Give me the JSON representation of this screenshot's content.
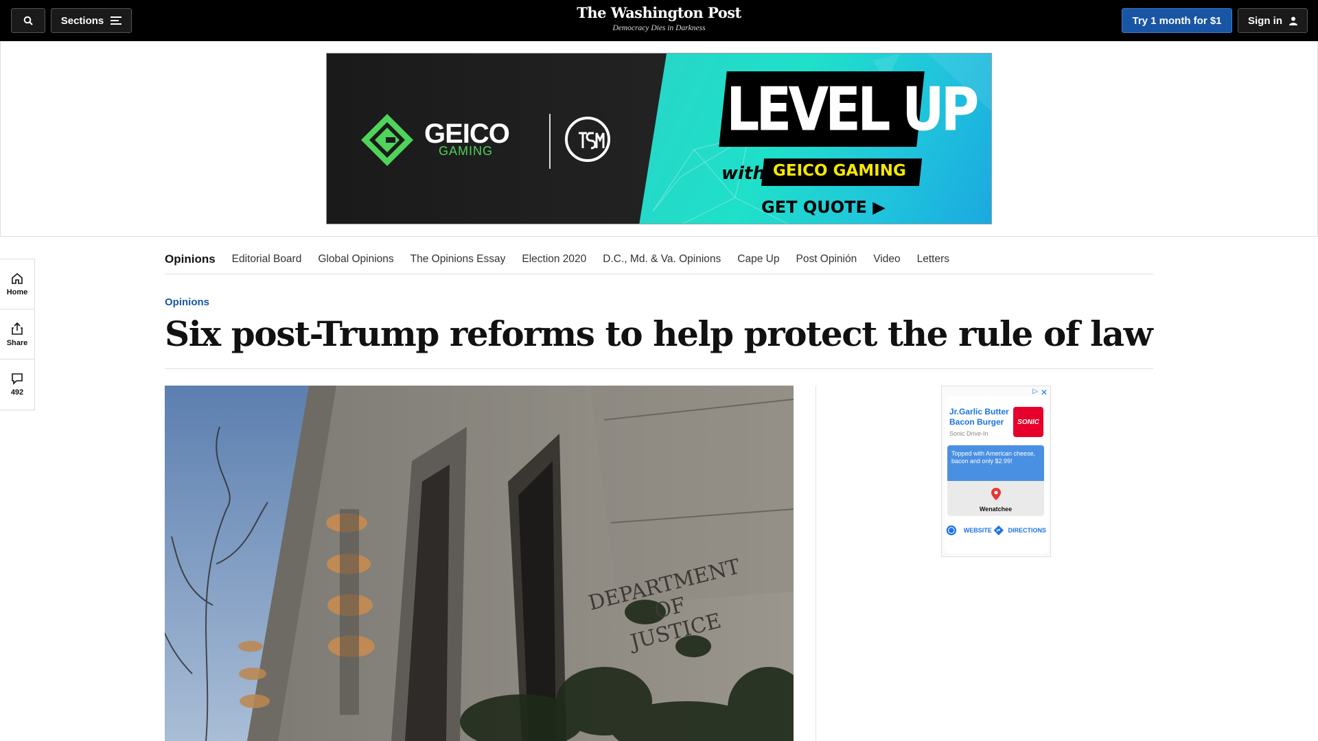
{
  "header": {
    "sections_label": "Sections",
    "masthead_title": "The Washington Post",
    "masthead_tagline": "Democracy Dies in Darkness",
    "subscribe_label": "Try 1 month for $1",
    "signin_label": "Sign in"
  },
  "banner_ad": {
    "brand_word": "GEICO",
    "brand_sub": "GAMING",
    "headline": "LEVEL UP",
    "with": "with",
    "brand_line": "GEICO GAMING",
    "cta": "GET QUOTE ▶",
    "colors": {
      "accent": "#27d5c8",
      "yellow": "#f5e700",
      "green": "#4fd35a"
    }
  },
  "opinions_nav": {
    "items": [
      "Opinions",
      "Editorial Board",
      "Global Opinions",
      "The Opinions Essay",
      "Election 2020",
      "D.C., Md. & Va. Opinions",
      "Cape Up",
      "Post Opinión",
      "Video",
      "Letters"
    ]
  },
  "rail": {
    "home_label": "Home",
    "share_label": "Share",
    "comments_count": "492"
  },
  "article": {
    "kicker": "Opinions",
    "headline": "Six post-Trump reforms to help protect the rule of law",
    "photo_sign_lines": [
      "DEPARTMENT",
      "OF",
      "JUSTICE"
    ]
  },
  "side_ad": {
    "title": "Jr.Garlic Butter Bacon Burger",
    "brand": "Sonic Drive-In",
    "logo_text": "SONIC",
    "promo": "Topped with American cheese, bacon and only $2.99!",
    "city": "Wenatchee",
    "website_label": "WEBSITE",
    "directions_label": "DIRECTIONS"
  },
  "colors": {
    "brand_blue": "#1955a5",
    "top_bar": "#000000"
  }
}
